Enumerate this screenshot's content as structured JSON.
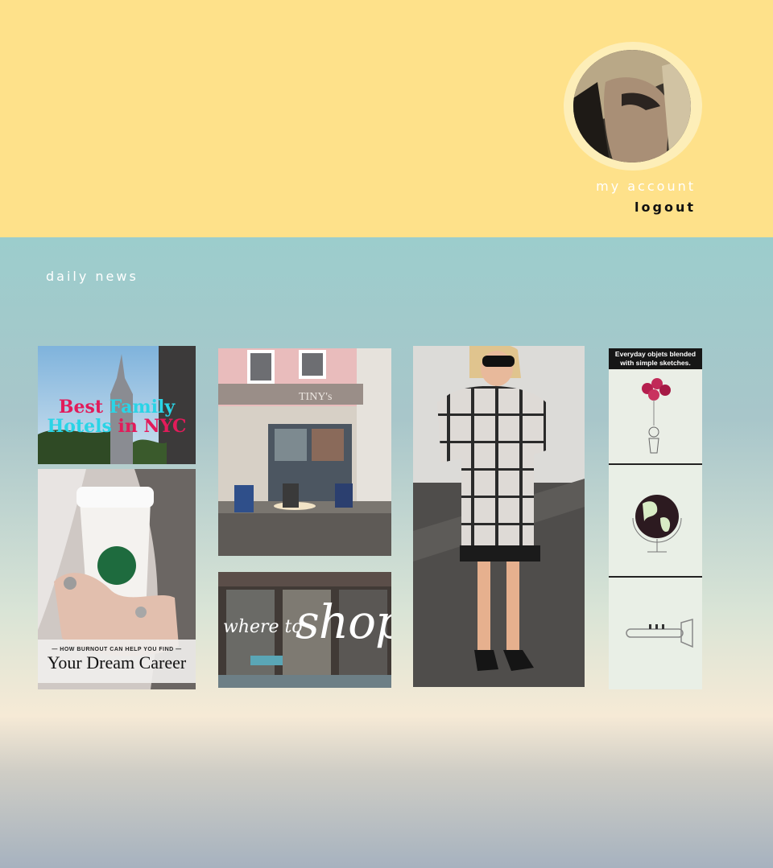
{
  "header": {
    "avatar_alt": "profile photo",
    "my_account": "my account",
    "logout": "logout"
  },
  "section": {
    "title": "daily news"
  },
  "tiles": {
    "hotels": {
      "line1_a": "Best",
      "line1_b": "Family",
      "line2_a": "Hotels",
      "line2_b": "in NYC"
    },
    "cafe": {
      "sign": "TINY's"
    },
    "career": {
      "kicker": "— HOW BURNOUT CAN HELP YOU FIND —",
      "headline": "Your Dream Career"
    },
    "shop": {
      "small": "where to",
      "big": "shop"
    },
    "sketch": {
      "banner": "Everyday objets blended with simple sketches."
    }
  },
  "colors": {
    "header_bg": "#fee18a",
    "accent_red": "#e21b5a",
    "accent_cyan": "#2ad4e6"
  }
}
